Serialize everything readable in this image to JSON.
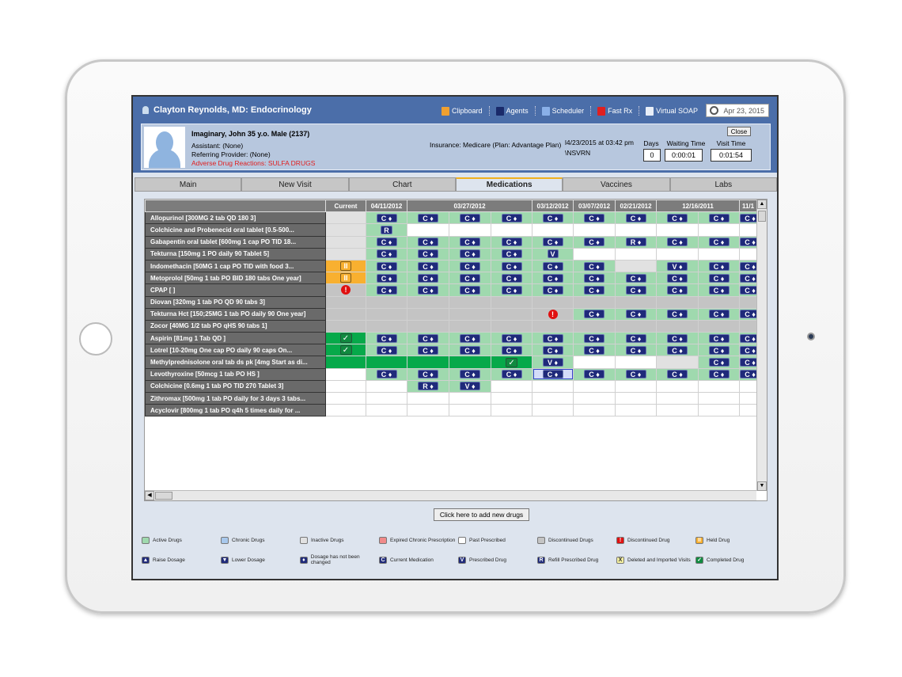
{
  "header": {
    "title": "Clayton Reynolds, MD: Endocrinology",
    "tools": [
      {
        "label": "Clipboard",
        "icon": "clipboard-icon",
        "color": "#f0a030"
      },
      {
        "label": "Agents",
        "icon": "envelope-icon",
        "color": "#1a2a6a"
      },
      {
        "label": "Scheduler",
        "icon": "calendar-icon",
        "color": "#8ab0e8"
      },
      {
        "label": "Fast Rx",
        "icon": "lightning-icon",
        "color": "#e02020"
      },
      {
        "label": "Virtual SOAP",
        "icon": "document-icon",
        "color": "#e8eef8"
      }
    ],
    "date": "Apr 23, 2015"
  },
  "patient": {
    "name": "Imaginary, John 35 y.o. Male (2137)",
    "assistant": "Assistant: (None)",
    "referring": "Referring Provider: (None)",
    "adr": "Adverse Drug Reactions: SULFA DRUGS",
    "insurance": "Insurance: Medicare (Plan: Advantage Plan)",
    "visit_datetime": "l4/23/2015 at 03:42 pm",
    "visit_code": "\\NSVRN",
    "close": "Close",
    "days_label": "Days",
    "days": "0",
    "waiting_label": "Waiting Time",
    "waiting": "0:00:01",
    "visit_label": "Visit Time",
    "visit": "0:01:54"
  },
  "tabs": [
    {
      "label": "Main"
    },
    {
      "label": "New Visit"
    },
    {
      "label": "Chart"
    },
    {
      "label": "Medications",
      "active": true
    },
    {
      "label": "Vaccines"
    },
    {
      "label": "Labs"
    }
  ],
  "grid": {
    "headers": [
      {
        "label": "Current",
        "span": 1
      },
      {
        "label": "04/11/2012",
        "span": 1
      },
      {
        "label": "03/27/2012",
        "span": 3
      },
      {
        "label": "03/12/2012",
        "span": 1
      },
      {
        "label": "03/07/2012",
        "span": 1
      },
      {
        "label": "02/21/2012",
        "span": 1
      },
      {
        "label": "12/16/2011",
        "span": 2
      },
      {
        "label": "11/1",
        "span": 1
      }
    ],
    "rows": [
      {
        "name": "Allopurinol   [300MG  2 tab QD 180 3]",
        "cells": [
          "inactive",
          "active:C+",
          "active:C+",
          "active:C+",
          "active:C+",
          "active:C+",
          "active:C+",
          "active:C+",
          "active:C+",
          "active:C+",
          "active:C+"
        ]
      },
      {
        "name": "Colchicine and Probenecid oral tablet        [0.5-500...",
        "cells": [
          "inactive",
          "active:R",
          "white",
          "white",
          "white",
          "white",
          "white",
          "white",
          "white",
          "white",
          "white"
        ]
      },
      {
        "name": "Gabapentin oral tablet          [600mg  1 cap PO TID 18...",
        "cells": [
          "inactive",
          "active:C+",
          "active:C+",
          "active:C+",
          "active:C+",
          "active:C+",
          "active:C+",
          "active:R+",
          "active:C+",
          "active:C+",
          "active:C+"
        ]
      },
      {
        "name": "Tekturna       [150mg  1 PO daily 90 Tablet 5]",
        "cells": [
          "inactive",
          "active:C+",
          "active:C+",
          "active:C+",
          "active:C+",
          "active:V",
          "white",
          "white",
          "white",
          "white",
          "white"
        ]
      },
      {
        "name": "Indomethacin          [50MG  1 cap PO TID with food 3...",
        "cells": [
          "held:pause",
          "active:C+",
          "active:C+",
          "active:C+",
          "active:C+",
          "active:C+",
          "active:C+",
          "inactive",
          "active:V+",
          "active:C+",
          "active:C+"
        ]
      },
      {
        "name": "Metoprolol   [50mg  1 tab PO BID 180 tabs One year]",
        "cells": [
          "held:pause",
          "active:C+",
          "active:C+",
          "active:C+",
          "active:C+",
          "active:C+",
          "active:C+",
          "active:C+",
          "active:C+",
          "active:C+",
          "active:C+"
        ]
      },
      {
        "name": "CPAP [    ]",
        "cells": [
          "disc:!",
          "active:C+",
          "active:C+",
          "active:C+",
          "active:C+",
          "active:C+",
          "active:C+",
          "active:C+",
          "active:C+",
          "active:C+",
          "active:C+"
        ]
      },
      {
        "name": "Diovan          [320mg  1 tab PO QD 90 tabs 3]",
        "cells": [
          "disc",
          "disc",
          "disc",
          "disc",
          "disc",
          "disc",
          "disc",
          "disc",
          "disc",
          "disc",
          "disc"
        ]
      },
      {
        "name": "Tekturna Hct [150;25MG  1 tab PO daily 90 One year]",
        "cells": [
          "disc",
          "disc",
          "disc",
          "disc",
          "disc",
          "disc:!",
          "active:C+",
          "active:C+",
          "active:C+",
          "active:C+",
          "active:C+"
        ]
      },
      {
        "name": "Zocor           [40MG  1/2 tab PO qHS 90 tabs 1]",
        "cells": [
          "disc",
          "disc",
          "disc",
          "disc",
          "disc",
          "disc",
          "disc",
          "disc",
          "disc",
          "disc",
          "disc"
        ]
      },
      {
        "name": "Aspirin         [81mg  1 Tab QD  ]",
        "cells": [
          "done:check",
          "active:C+",
          "active:C+",
          "active:C+",
          "active:C+",
          "active:C+",
          "active:C+",
          "active:C+",
          "active:C+",
          "active:C+",
          "active:C+"
        ]
      },
      {
        "name": "Lotrel          [10-20mg  One cap PO daily 90 caps On...",
        "cells": [
          "done:check",
          "active:C+",
          "active:C+",
          "active:C+",
          "active:C+",
          "active:C+",
          "active:C+",
          "active:C+",
          "active:C+",
          "active:C+",
          "active:C+"
        ]
      },
      {
        "name": "Methylprednisolone oral tab ds pk [4mg  Start as di...",
        "cells": [
          "done",
          "done",
          "done",
          "done",
          "done:check",
          "active:V+",
          "white",
          "white",
          "inactive",
          "active:C+",
          "active:C+"
        ]
      },
      {
        "name": "Levothyroxine          [50mcg  1 tab PO HS  ]",
        "cells": [
          "white",
          "active:C+",
          "active:C+",
          "active:C+",
          "active:C+",
          "sel:C+",
          "active:C+",
          "active:C+",
          "active:C+",
          "active:C+",
          "active:C+"
        ]
      },
      {
        "name": "Colchicine     [0.6mg  1 tab PO TID 270 Tablet 3]",
        "cells": [
          "white",
          "white",
          "active:R+",
          "active:V+",
          "white",
          "white",
          "white",
          "white",
          "white",
          "white",
          "white"
        ]
      },
      {
        "name": "Zithromax      [500mg  1 tab PO daily for 3 days 3 tabs...",
        "cells": [
          "white",
          "white",
          "white",
          "white",
          "white",
          "white",
          "white",
          "white",
          "white",
          "white",
          "white"
        ]
      },
      {
        "name": "Acyclovir      [800mg  1 tab PO q4h 5 times daily for ...",
        "cells": [
          "white",
          "white",
          "white",
          "white",
          "white",
          "white",
          "white",
          "white",
          "white",
          "white",
          "white"
        ]
      }
    ]
  },
  "add_button": "Click here to add new drugs",
  "legend": [
    [
      {
        "label": "Active Drugs",
        "color": "#9fd9ae",
        "glyph": ""
      },
      {
        "label": "Chronic Drugs",
        "color": "#a8c8ec",
        "glyph": ""
      },
      {
        "label": "Inactive Drugs",
        "color": "#e1e1e1",
        "glyph": ""
      },
      {
        "label": "Expired Chronic Prescription",
        "color": "#f08a8a",
        "glyph": ""
      },
      {
        "label": "Past Prescribed",
        "color": "#ffffff",
        "glyph": ""
      },
      {
        "label": "Discontinued Drugs",
        "color": "#c4c4c4",
        "glyph": ""
      },
      {
        "label": "Discontinued Drug",
        "color": "#e01010",
        "glyph": "!"
      },
      {
        "label": "Held Drug",
        "color": "#f8b030",
        "glyph": "II"
      }
    ],
    [
      {
        "label": "Raise Dosage",
        "color": "#1f2a7a",
        "glyph": "▲"
      },
      {
        "label": "Lower Dosage",
        "color": "#1f2a7a",
        "glyph": "▼"
      },
      {
        "label": "Dosage has not been changed",
        "color": "#1f2a7a",
        "glyph": "♦"
      },
      {
        "label": "Current Medication",
        "color": "#1f2a7a",
        "glyph": "C"
      },
      {
        "label": "Prescribed Drug",
        "color": "#1f2a7a",
        "glyph": "V"
      },
      {
        "label": "Refill Prescribed Drug",
        "color": "#1f2a7a",
        "glyph": "R"
      },
      {
        "label": "Deleted and Imported Visits",
        "color": "#f4f0a0",
        "glyph": "X"
      },
      {
        "label": "Completed Drug",
        "color": "#108a40",
        "glyph": "✓"
      }
    ]
  ]
}
